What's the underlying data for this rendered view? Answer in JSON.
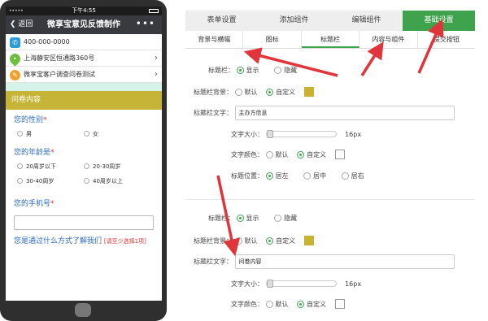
{
  "phone": {
    "status": {
      "signal": "•••••",
      "time": "下午4:55"
    },
    "nav": {
      "back": "返回",
      "title": "微享宝意见反馈制作",
      "more": "•••"
    },
    "info": [
      {
        "icon": "phone-icon",
        "text": "400-000-0000"
      },
      {
        "icon": "map-pin-icon",
        "text": "上海静安区恒通路360号"
      },
      {
        "icon": "pen-icon",
        "text": "微享宝客户调查问卷测试"
      }
    ],
    "section_title": "问卷内容",
    "questions": {
      "gender": {
        "label": "您的性别",
        "options": [
          "男",
          "女"
        ]
      },
      "age": {
        "label": "您的年龄是",
        "options": [
          "20周岁以下",
          "20-30周岁",
          "30-40周岁",
          "40周岁以上"
        ]
      },
      "mobile": {
        "label": "您的手机号"
      },
      "source": {
        "label": "您是通过什么方式了解我们",
        "hint": "[请至少选择1项]"
      }
    },
    "required_mark": "*"
  },
  "panel": {
    "top_tabs": [
      "表单设置",
      "添加组件",
      "编辑组件",
      "基础设置"
    ],
    "sub_tabs": [
      "背景与横幅",
      "图标",
      "标题栏",
      "内容与组件",
      "提交按钮"
    ],
    "blocks": [
      {
        "title_bar_label": "标题栏：",
        "show": "显示",
        "hide": "隐藏",
        "bg_label": "标题栏背景：",
        "default": "默认",
        "custom": "自定义",
        "bg_color": "#c9b231",
        "text_label": "标题栏文字：",
        "text_value": "主办方信息",
        "size_label": "文字大小：",
        "size_value": "16px",
        "color_label": "文字颜色：",
        "pos_label": "标题位置：",
        "left": "居左",
        "center": "居中",
        "right": "居右"
      },
      {
        "title_bar_label": "标题栏：",
        "show": "显示",
        "hide": "隐藏",
        "bg_label": "标题栏背景：",
        "default": "默认",
        "custom": "自定义",
        "bg_color": "#c9b231",
        "text_label": "标题栏文字：",
        "text_value": "问卷内容",
        "size_label": "文字大小：",
        "size_value": "16px",
        "color_label": "文字颜色："
      }
    ]
  },
  "colors": {
    "accent": "#3fa34d",
    "arrow": "#e0353b",
    "section": "#c5b435"
  }
}
